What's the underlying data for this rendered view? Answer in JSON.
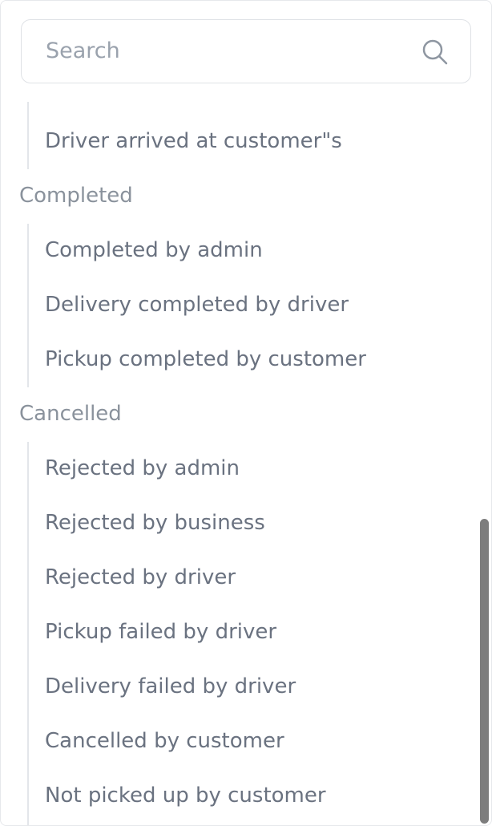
{
  "search": {
    "placeholder": "Search",
    "value": ""
  },
  "groups": [
    {
      "items": [
        "Driver arrived at customer\"s"
      ]
    },
    {
      "label": "Completed",
      "items": [
        "Completed by admin",
        "Delivery completed by driver",
        "Pickup completed by customer"
      ]
    },
    {
      "label": "Cancelled",
      "items": [
        "Rejected by admin",
        "Rejected by business",
        "Rejected by driver",
        "Pickup failed by driver",
        "Delivery failed by driver",
        "Cancelled by customer",
        "Not picked up by customer"
      ]
    }
  ],
  "icons": {
    "search": "search-icon"
  },
  "colors": {
    "text": "#6a7280",
    "group": "#8a929c",
    "border": "#dfe2e6",
    "scrollbar": "#7d7d7d"
  }
}
